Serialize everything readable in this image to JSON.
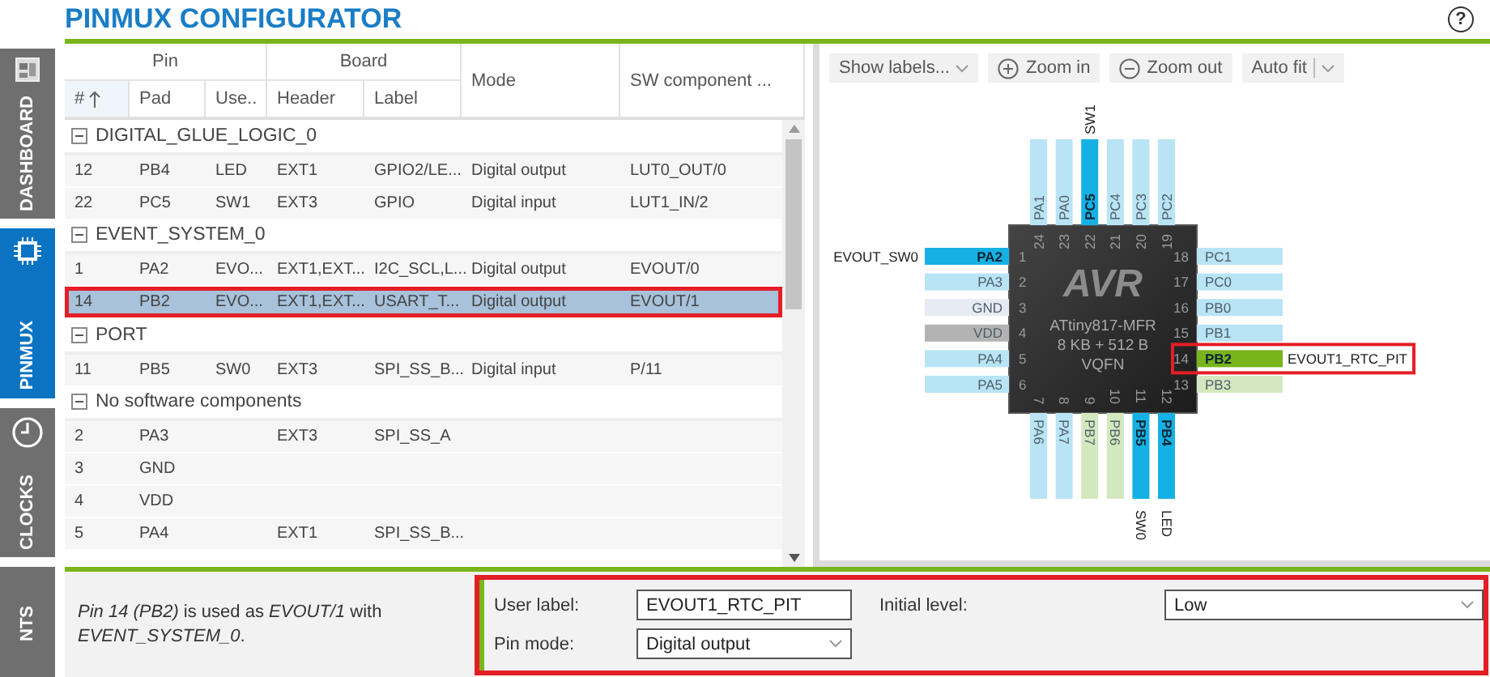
{
  "header": {
    "title": "PINMUX CONFIGURATOR",
    "help": "?"
  },
  "sidebar": {
    "tabs": [
      {
        "label": "DASHBOARD",
        "kind": "dashboard",
        "selected": false
      },
      {
        "label": "PINMUX",
        "kind": "pinmux",
        "selected": true
      },
      {
        "label": "CLOCKS",
        "kind": "clocks",
        "selected": false
      },
      {
        "label": "NTS",
        "kind": "plain",
        "selected": false
      }
    ]
  },
  "table": {
    "header": [
      {
        "label": "Pin",
        "columns": [
          {
            "label": "#",
            "sorted": true
          },
          {
            "label": "Pad",
            "sorted": false
          },
          {
            "label": "Use..",
            "sorted": false
          }
        ]
      },
      {
        "label": "Board",
        "columns": [
          {
            "label": "Header",
            "sorted": false
          },
          {
            "label": "Label",
            "sorted": false
          }
        ]
      },
      {
        "label": "Mode",
        "sorted": false
      },
      {
        "label": "SW component ...",
        "sorted": false
      }
    ],
    "groups": [
      {
        "name": "DIGITAL_GLUE_LOGIC_0",
        "expanded": true,
        "rows": [
          {
            "number": "12",
            "pad": "PB4",
            "user": "LED",
            "header": "EXT1",
            "label": "GPIO2/LE...",
            "mode": "Digital output",
            "sw_component": "LUT0_OUT/0",
            "selected": false
          },
          {
            "number": "22",
            "pad": "PC5",
            "user": "SW1",
            "header": "EXT3",
            "label": "GPIO",
            "mode": "Digital input",
            "sw_component": "LUT1_IN/2",
            "selected": false
          }
        ]
      },
      {
        "name": "EVENT_SYSTEM_0",
        "expanded": true,
        "rows": [
          {
            "number": "1",
            "pad": "PA2",
            "user": "EVO...",
            "header": "EXT1,EXT...",
            "label": "I2C_SCL,L...",
            "mode": "Digital output",
            "sw_component": "EVOUT/0",
            "selected": false
          },
          {
            "number": "14",
            "pad": "PB2",
            "user": "EVO...",
            "header": "EXT1,EXT...",
            "label": "USART_T...",
            "mode": "Digital output",
            "sw_component": "EVOUT/1",
            "selected": true,
            "highlighted": true
          }
        ]
      },
      {
        "name": "PORT",
        "expanded": true,
        "rows": [
          {
            "number": "11",
            "pad": "PB5",
            "user": "SW0",
            "header": "EXT3",
            "label": "SPI_SS_B...",
            "mode": "Digital input",
            "sw_component": "P/11",
            "selected": false
          }
        ]
      },
      {
        "name": "No software components",
        "expanded": true,
        "rows": [
          {
            "number": "2",
            "pad": "PA3",
            "header": "EXT3",
            "label": "SPI_SS_A",
            "selected": false
          },
          {
            "number": "3",
            "pad": "GND",
            "selected": false
          },
          {
            "number": "4",
            "pad": "VDD",
            "selected": false
          },
          {
            "number": "5",
            "pad": "PA4",
            "header": "EXT1",
            "label": "SPI_SS_B...",
            "selected": false
          }
        ]
      }
    ]
  },
  "pinout": {
    "toolbar": [
      {
        "label": "Show labels...",
        "kind": "dropdown"
      },
      {
        "label": "Zoom in",
        "kind": "zoom_in"
      },
      {
        "label": "Zoom out",
        "kind": "zoom_out"
      },
      {
        "label": "Auto fit",
        "kind": "split"
      }
    ],
    "chip": {
      "logo": "AVR",
      "name": "ATtiny817-MFR",
      "memory": "8 KB + 512 B",
      "package": "VQFN",
      "pins": {
        "left": [
          {
            "number": "1",
            "pad": "PA2",
            "color": "#16b1e4",
            "used": true,
            "label": "EVOUT_SW0"
          },
          {
            "number": "2",
            "pad": "PA3",
            "color": "#b8e4f5",
            "used": false
          },
          {
            "number": "3",
            "pad": "GND",
            "color": "#e6eaf3",
            "used": false
          },
          {
            "number": "4",
            "pad": "VDD",
            "color": "#b3b3b3",
            "used": false
          },
          {
            "number": "5",
            "pad": "PA4",
            "color": "#b8e4f5",
            "used": false
          },
          {
            "number": "6",
            "pad": "PA5",
            "color": "#b8e4f5",
            "used": false
          }
        ],
        "right": [
          {
            "number": "18",
            "pad": "PC1",
            "color": "#b8e4f5",
            "used": false
          },
          {
            "number": "17",
            "pad": "PC0",
            "color": "#b8e4f5",
            "used": false
          },
          {
            "number": "16",
            "pad": "PB0",
            "color": "#b8e4f5",
            "used": false
          },
          {
            "number": "15",
            "pad": "PB1",
            "color": "#b8e4f5",
            "used": false
          },
          {
            "number": "14",
            "pad": "PB2",
            "color": "#78b41c",
            "used": true,
            "label": "EVOUT1_RTC_PIT",
            "highlighted": true
          },
          {
            "number": "13",
            "pad": "PB3",
            "color": "#d4e8bf",
            "used": false
          }
        ],
        "top": [
          {
            "number": "24",
            "pad": "PA1",
            "color": "#b8e4f5",
            "used": false
          },
          {
            "number": "23",
            "pad": "PA0",
            "color": "#b8e4f5",
            "used": false
          },
          {
            "number": "22",
            "pad": "PC5",
            "color": "#16b1e4",
            "used": true,
            "label": "SW1"
          },
          {
            "number": "21",
            "pad": "PC4",
            "color": "#b8e4f5",
            "used": false
          },
          {
            "number": "20",
            "pad": "PC3",
            "color": "#b8e4f5",
            "used": false
          },
          {
            "number": "19",
            "pad": "PC2",
            "color": "#b8e4f5",
            "used": false
          }
        ],
        "bottom": [
          {
            "number": "7",
            "pad": "PA6",
            "color": "#b8e4f5",
            "used": false
          },
          {
            "number": "8",
            "pad": "PA7",
            "color": "#b8e4f5",
            "used": false
          },
          {
            "number": "9",
            "pad": "PB7",
            "color": "#d4e8bf",
            "used": false
          },
          {
            "number": "10",
            "pad": "PB6",
            "color": "#d4e8bf",
            "used": false
          },
          {
            "number": "11",
            "pad": "PB5",
            "color": "#16b1e4",
            "used": true,
            "label": "SW0"
          },
          {
            "number": "12",
            "pad": "PB4",
            "color": "#16b1e4",
            "used": true,
            "label": "LED"
          }
        ]
      }
    }
  },
  "details": {
    "description": "*Pin 14 (PB2)* is used as *EVOUT/1* with *EVENT_SYSTEM_0*.",
    "highlighted": true,
    "fields": [
      {
        "label": "User label:",
        "kind": "text",
        "value": "EVOUT1_RTC_PIT"
      },
      {
        "label": "Initial level:",
        "kind": "select",
        "value": "Low"
      },
      {
        "label": "Pin mode:",
        "kind": "select",
        "value": "Digital output"
      }
    ]
  }
}
